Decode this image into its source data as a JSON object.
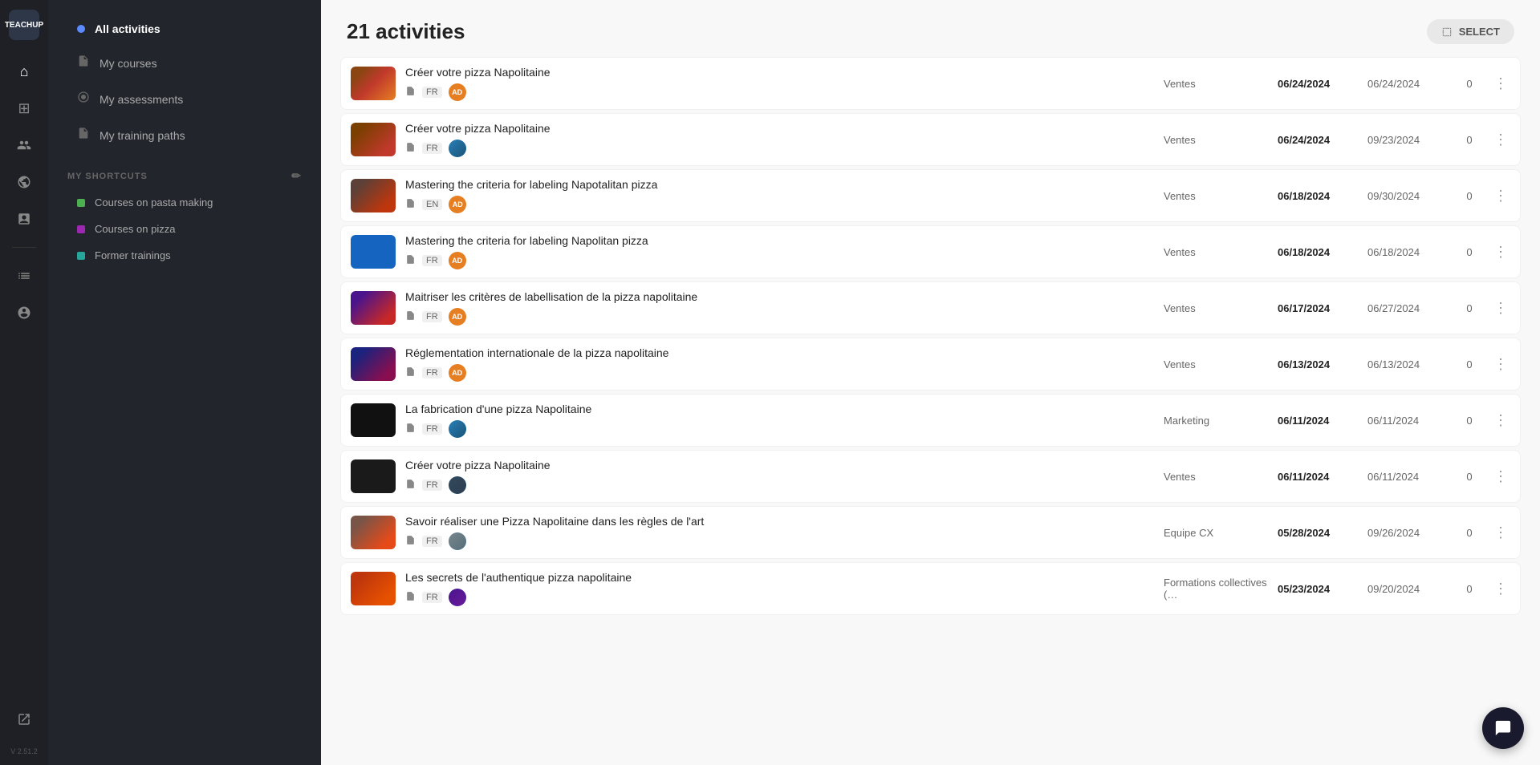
{
  "app": {
    "logo_line1": "TEACH",
    "logo_line2": "UP",
    "version": "V 2.51.2"
  },
  "sidebar": {
    "nav_items": [
      {
        "id": "all-activities",
        "label": "All activities",
        "active": true,
        "icon": "●"
      },
      {
        "id": "my-courses",
        "label": "My courses",
        "active": false,
        "icon": "📄"
      },
      {
        "id": "my-assessments",
        "label": "My assessments",
        "active": false,
        "icon": "◎"
      },
      {
        "id": "my-training-paths",
        "label": "My training paths",
        "active": false,
        "icon": "📋"
      }
    ],
    "shortcuts_header": "MY SHORTCUTS",
    "shortcuts_edit_icon": "✏",
    "shortcuts": [
      {
        "id": "courses-pasta",
        "label": "Courses on pasta making",
        "color": "green"
      },
      {
        "id": "courses-pizza",
        "label": "Courses on pizza",
        "color": "purple"
      },
      {
        "id": "former-trainings",
        "label": "Former trainings",
        "color": "teal"
      }
    ]
  },
  "rail_icons": [
    {
      "id": "home",
      "icon": "⌂",
      "label": "home-icon"
    },
    {
      "id": "dashboard",
      "icon": "⊞",
      "label": "dashboard-icon"
    },
    {
      "id": "users",
      "icon": "👥",
      "label": "users-icon"
    },
    {
      "id": "globe",
      "icon": "◎",
      "label": "globe-icon"
    },
    {
      "id": "reports",
      "icon": "▤",
      "label": "reports-icon"
    },
    {
      "id": "analytics",
      "icon": "⚙",
      "label": "analytics-icon"
    },
    {
      "id": "admin",
      "icon": "👤",
      "label": "admin-icon"
    }
  ],
  "main": {
    "title": "21 activities",
    "select_button": "SELECT",
    "activities": [
      {
        "id": 1,
        "title": "Créer votre pizza Napolitaine",
        "thumb_class": "thumb-pizza1",
        "lang": "FR",
        "avatar_type": "orange",
        "avatar_text": "AD",
        "category": "Ventes",
        "date_start": "06/24/2024",
        "date_end": "06/24/2024",
        "count": "0"
      },
      {
        "id": 2,
        "title": "Créer votre pizza Napolitaine",
        "thumb_class": "thumb-pizza2",
        "lang": "FR",
        "avatar_type": "img",
        "category": "Ventes",
        "date_start": "06/24/2024",
        "date_end": "09/23/2024",
        "count": "0"
      },
      {
        "id": 3,
        "title": "Mastering the criteria for labeling Napotalitan pizza",
        "thumb_class": "thumb-pizza3",
        "lang": "EN",
        "avatar_type": "orange",
        "avatar_text": "AD",
        "category": "Ventes",
        "date_start": "06/18/2024",
        "date_end": "09/30/2024",
        "count": "0"
      },
      {
        "id": 4,
        "title": "Mastering the criteria for labeling Napolitan pizza",
        "thumb_class": "thumb-blue",
        "lang": "FR",
        "avatar_type": "orange",
        "avatar_text": "AD",
        "category": "Ventes",
        "date_start": "06/18/2024",
        "date_end": "06/18/2024",
        "count": "0"
      },
      {
        "id": 5,
        "title": "Maitriser les critères de labellisation de la pizza napolitaine",
        "thumb_class": "thumb-pizza4",
        "lang": "FR",
        "avatar_type": "orange",
        "avatar_text": "AD",
        "category": "Ventes",
        "date_start": "06/17/2024",
        "date_end": "06/27/2024",
        "count": "0"
      },
      {
        "id": 6,
        "title": "Réglementation internationale de la pizza napolitaine",
        "thumb_class": "thumb-pizza5",
        "lang": "FR",
        "avatar_type": "orange",
        "avatar_text": "AD",
        "category": "Ventes",
        "date_start": "06/13/2024",
        "date_end": "06/13/2024",
        "count": "0"
      },
      {
        "id": 7,
        "title": "La fabrication d'une pizza Napolitaine",
        "thumb_class": "thumb-dark",
        "lang": "FR",
        "avatar_type": "img",
        "category": "Marketing",
        "date_start": "06/11/2024",
        "date_end": "06/11/2024",
        "count": "0"
      },
      {
        "id": 8,
        "title": "Créer votre pizza Napolitaine",
        "thumb_class": "thumb-dark",
        "lang": "FR",
        "avatar_type": "img",
        "category": "Ventes",
        "date_start": "06/11/2024",
        "date_end": "06/11/2024",
        "count": "0"
      },
      {
        "id": 9,
        "title": "Savoir réaliser une Pizza Napolitaine dans les règles de l'art",
        "thumb_class": "thumb-pizza1",
        "lang": "FR",
        "avatar_type": "img2",
        "category": "Equipe CX",
        "date_start": "05/28/2024",
        "date_end": "09/26/2024",
        "count": "0"
      },
      {
        "id": 10,
        "title": "Les secrets de l'authentique pizza napolitaine",
        "thumb_class": "thumb-pizza2",
        "lang": "FR",
        "avatar_type": "img3",
        "category": "Formations collectives (…",
        "date_start": "05/23/2024",
        "date_end": "09/20/2024",
        "count": "0"
      }
    ]
  }
}
